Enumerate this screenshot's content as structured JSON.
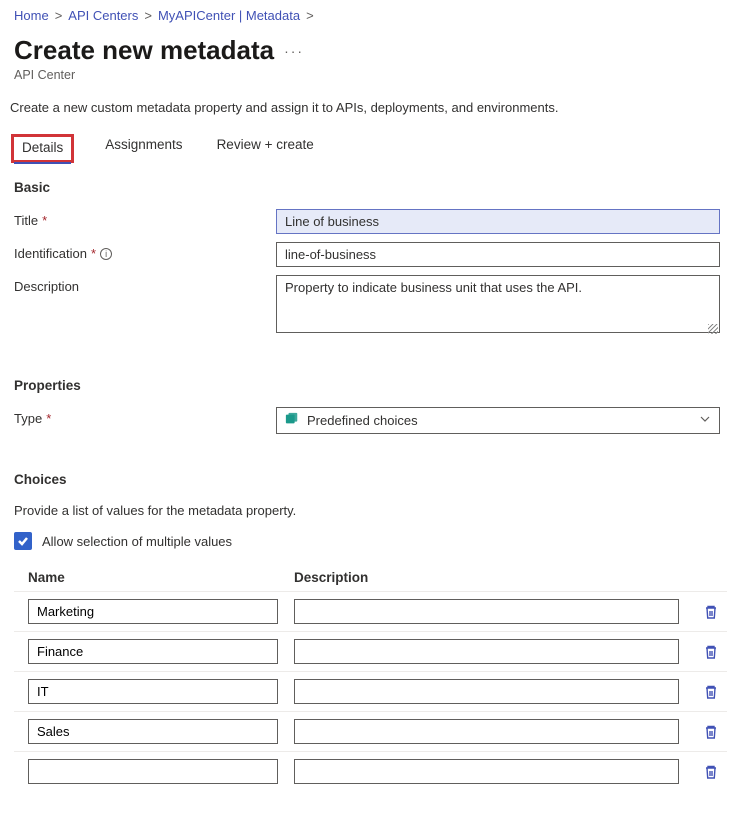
{
  "breadcrumb": {
    "items": [
      {
        "label": "Home"
      },
      {
        "label": "API Centers"
      },
      {
        "label": "MyAPICenter | Metadata"
      }
    ]
  },
  "title": "Create new metadata",
  "subtitle": "API Center",
  "intro": "Create a new custom metadata property and assign it to APIs, deployments, and environments.",
  "tabs": [
    {
      "label": "Details",
      "active": true
    },
    {
      "label": "Assignments",
      "active": false
    },
    {
      "label": "Review + create",
      "active": false
    }
  ],
  "sections": {
    "basic": {
      "heading": "Basic",
      "fields": {
        "title": {
          "label": "Title",
          "required": true,
          "value": "Line of business"
        },
        "identification": {
          "label": "Identification",
          "required": true,
          "info": true,
          "value": "line-of-business"
        },
        "description": {
          "label": "Description",
          "required": false,
          "value": "Property to indicate business unit that uses the API."
        }
      }
    },
    "properties": {
      "heading": "Properties",
      "fields": {
        "type": {
          "label": "Type",
          "required": true,
          "value": "Predefined choices"
        }
      }
    },
    "choices": {
      "heading": "Choices",
      "caption": "Provide a list of values for the metadata property.",
      "allow_multiple_label": "Allow selection of multiple values",
      "allow_multiple": true,
      "columns": {
        "name": "Name",
        "description": "Description"
      },
      "rows": [
        {
          "name": "Marketing",
          "description": ""
        },
        {
          "name": "Finance",
          "description": ""
        },
        {
          "name": "IT",
          "description": ""
        },
        {
          "name": "Sales",
          "description": ""
        },
        {
          "name": "",
          "description": ""
        }
      ]
    }
  }
}
